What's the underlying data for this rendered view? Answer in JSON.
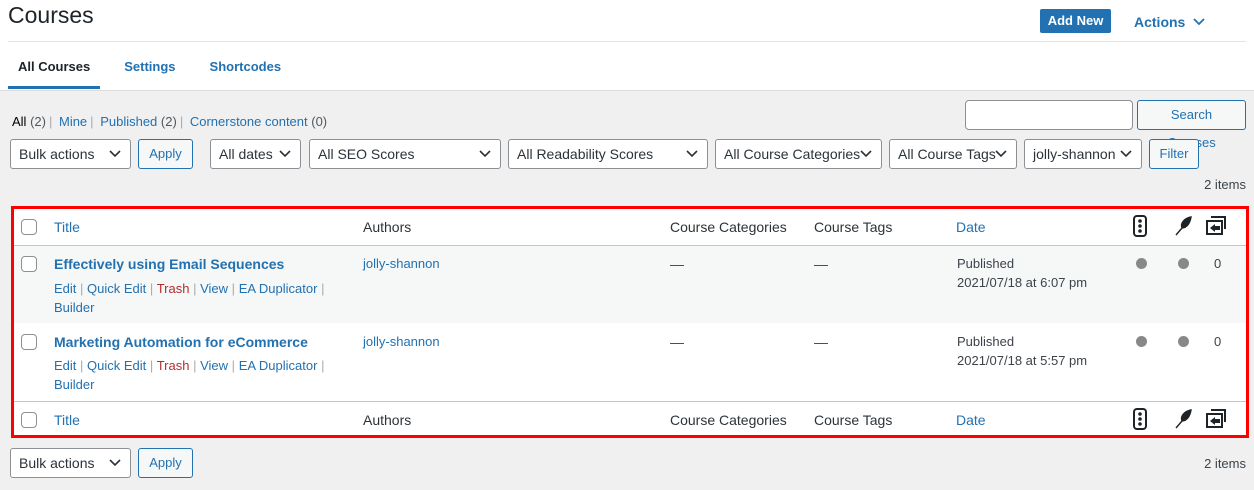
{
  "header": {
    "title": "Courses",
    "add_new": "Add New",
    "actions": "Actions"
  },
  "tabs": [
    {
      "label": "All Courses"
    },
    {
      "label": "Settings"
    },
    {
      "label": "Shortcodes"
    }
  ],
  "views": {
    "all": "All",
    "all_count": "(2)",
    "mine": "Mine",
    "published": "Published",
    "published_count": "(2)",
    "cornerstone": "Cornerstone content",
    "cornerstone_count": "(0)"
  },
  "search": {
    "value": "",
    "button": "Search Courses"
  },
  "filters": {
    "bulk_actions": "Bulk actions",
    "apply": "Apply",
    "dates": "All dates",
    "seo": "All SEO Scores",
    "readability": "All Readability Scores",
    "categories": "All Course Categories",
    "tags": "All Course Tags",
    "author": "jolly-shannon",
    "filter": "Filter"
  },
  "items_count": "2 items",
  "table": {
    "columns": {
      "title": "Title",
      "authors": "Authors",
      "categories": "Course Categories",
      "tags": "Course Tags",
      "date": "Date",
      "seo_icon": "traffic-light-icon",
      "readability_icon": "feather-icon",
      "links_icon": "outgoing-links-icon"
    },
    "rows": [
      {
        "title": "Effectively using Email Sequences",
        "author": "jolly-shannon",
        "categories": "—",
        "tags": "—",
        "status": "Published",
        "date": "2021/07/18 at 6:07 pm",
        "links": "0"
      },
      {
        "title": "Marketing Automation for eCommerce",
        "author": "jolly-shannon",
        "categories": "—",
        "tags": "—",
        "status": "Published",
        "date": "2021/07/18 at 5:57 pm",
        "links": "0"
      }
    ],
    "row_actions": {
      "edit": "Edit",
      "quick_edit": "Quick Edit",
      "trash": "Trash",
      "view": "View",
      "duplicator": "EA Duplicator",
      "builder": "Builder"
    }
  },
  "colors": {
    "accent": "#2271b1",
    "highlight_border": "#ff0000",
    "trash": "#b32d2e"
  }
}
